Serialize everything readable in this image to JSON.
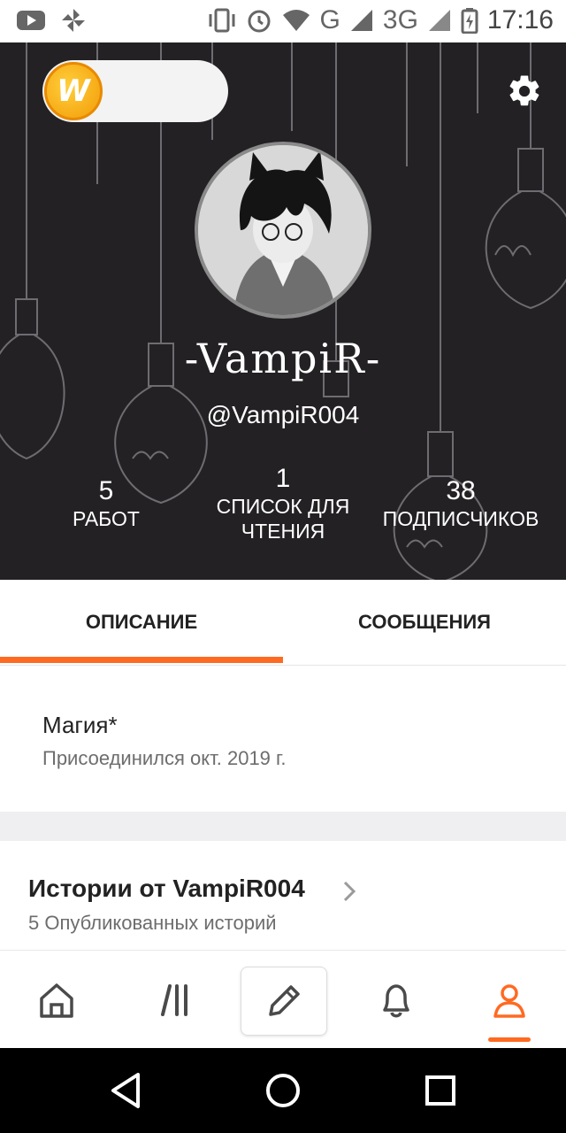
{
  "status_bar": {
    "time": "17:16",
    "network_g": "G",
    "network_3g": "3G",
    "icons": [
      "youtube-icon",
      "pinwheel-icon",
      "vibrate-icon",
      "alarm-icon",
      "wifi-icon",
      "signal-icon",
      "signal-icon",
      "battery-charging-icon"
    ]
  },
  "profile": {
    "display_name": "-VampiR-",
    "username": "@VampiR004",
    "stats": [
      {
        "value": "5",
        "label": "РАБОТ"
      },
      {
        "value": "1",
        "label_line1": "СПИСОК ДЛЯ",
        "label_line2": "ЧТЕНИЯ"
      },
      {
        "value": "38",
        "label": "ПОДПИСЧИКОВ"
      }
    ]
  },
  "tabs": {
    "about": "ОПИСАНИЕ",
    "messages": "СООБЩЕНИЯ",
    "active": "about"
  },
  "about": {
    "name": "Магия*",
    "joined": "Присоединился окт. 2019 г."
  },
  "stories": {
    "title": "Истории от VampiR004",
    "count": "5 Опубликованных историй"
  },
  "bottom_nav": {
    "items": [
      "home-icon",
      "library-icon",
      "write-icon",
      "notifications-icon",
      "profile-icon"
    ],
    "active": "profile-icon"
  },
  "colors": {
    "accent": "#ff6a22",
    "header_bg": "#232124",
    "coin": "#f7a514"
  }
}
